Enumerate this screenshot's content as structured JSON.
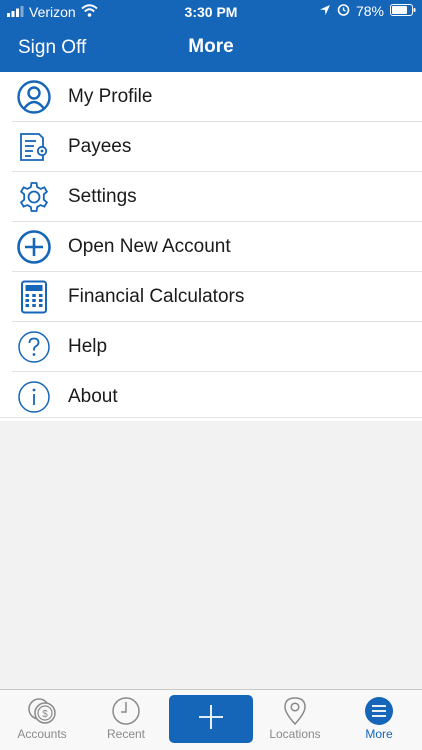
{
  "status_bar": {
    "carrier": "Verizon",
    "time": "3:30 PM",
    "battery": "78%"
  },
  "nav": {
    "left_action": "Sign Off",
    "title": "More"
  },
  "menu": {
    "items": [
      {
        "label": "My Profile",
        "icon": "profile-icon"
      },
      {
        "label": "Payees",
        "icon": "payees-icon"
      },
      {
        "label": "Settings",
        "icon": "gear-icon"
      },
      {
        "label": "Open New Account",
        "icon": "plus-circle-icon"
      },
      {
        "label": "Financial Calculators",
        "icon": "calculator-icon"
      },
      {
        "label": "Help",
        "icon": "question-icon"
      },
      {
        "label": "About",
        "icon": "info-icon"
      }
    ]
  },
  "tab_bar": {
    "tabs": [
      {
        "label": "Accounts",
        "icon": "dollar-coins-icon"
      },
      {
        "label": "Recent",
        "icon": "clock-icon"
      },
      {
        "label": "",
        "icon": "add-icon"
      },
      {
        "label": "Locations",
        "icon": "map-pin-icon"
      },
      {
        "label": "More",
        "icon": "menu-icon",
        "active": true
      }
    ]
  },
  "colors": {
    "brand": "#1565b9",
    "inactive_tab": "#8a8a8a",
    "background": "#f2f2f2"
  }
}
